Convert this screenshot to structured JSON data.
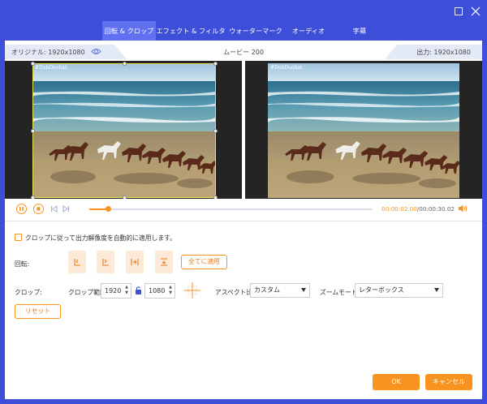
{
  "tabs": [
    {
      "label": "回転 & クロップ",
      "active": true
    },
    {
      "label": "エフェクト & フィルター",
      "active": false
    },
    {
      "label": "ウォーターマーク",
      "active": false
    },
    {
      "label": "オーディオ",
      "active": false
    },
    {
      "label": "字幕",
      "active": false
    }
  ],
  "window": {
    "maximize_icon": "maximize-icon",
    "close_icon": "close-icon"
  },
  "preview": {
    "original_label": "オリジナル: 1920x1080",
    "title": "ムービー 200",
    "output_label": "出力: 1920x1080",
    "watermark_text": "#DubDeohat"
  },
  "playback": {
    "current_time": "00:00:02.00",
    "separator": "/",
    "total_time": "00:00:30.02",
    "progress_percent": 6.7
  },
  "settings": {
    "auto_apply_label": "クロップに従って出力解像度を自動的に適用します。",
    "auto_apply_checked": false,
    "rotate_label": "回転:",
    "apply_all_label": "全てに適用",
    "crop_label": "クロップ:",
    "crop_area_label": "クロップ範囲:",
    "crop_width": "1920",
    "crop_height": "1080",
    "aspect_label": "アスペクト比:",
    "aspect_value": "カスタム",
    "zoom_label": "ズームモード:",
    "zoom_value": "レターボックス",
    "reset_label": "リセット"
  },
  "footer": {
    "ok_label": "OK",
    "cancel_label": "キャンセル"
  },
  "colors": {
    "accent": "#f7931e",
    "titlebar": "#3d4fd8",
    "active_tab": "#5f70f0"
  }
}
